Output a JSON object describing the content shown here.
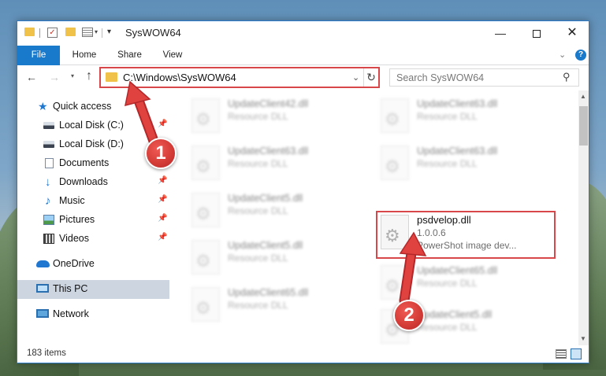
{
  "window": {
    "title": "SysWOW64",
    "controls": {
      "minimize": "—",
      "close": "✕"
    }
  },
  "quick_access_toolbar": {
    "check_glyph": "✓",
    "dropdown_glyph": "▾",
    "customize_glyph": "▾"
  },
  "ribbon": {
    "tabs": [
      "File",
      "Home",
      "Share",
      "View"
    ],
    "expand_glyph": "⌄",
    "help_glyph": "?"
  },
  "navigation": {
    "back_glyph": "←",
    "forward_glyph": "→",
    "recent_glyph": "▾",
    "up_glyph": "↑",
    "address_path": "C:\\Windows\\SysWOW64",
    "address_dropdown_glyph": "⌄",
    "refresh_glyph": "↻",
    "search_placeholder": "Search SysWOW64",
    "search_glyph": "⚲"
  },
  "sidebar": {
    "pin_glyph": "📌",
    "items": [
      {
        "label": "Quick access",
        "icon": "star-icon",
        "pinned": false
      },
      {
        "label": "Local Disk (C:)",
        "icon": "disk-icon",
        "pinned": true
      },
      {
        "label": "Local Disk (D:)",
        "icon": "disk-icon",
        "pinned": false
      },
      {
        "label": "Documents",
        "icon": "documents-icon",
        "pinned": true
      },
      {
        "label": "Downloads",
        "icon": "download-icon",
        "pinned": true
      },
      {
        "label": "Music",
        "icon": "music-icon",
        "pinned": true
      },
      {
        "label": "Pictures",
        "icon": "pictures-icon",
        "pinned": true
      },
      {
        "label": "Videos",
        "icon": "videos-icon",
        "pinned": true
      },
      {
        "label": "OneDrive",
        "icon": "onedrive-icon",
        "pinned": false
      },
      {
        "label": "This PC",
        "icon": "this-pc-icon",
        "pinned": false,
        "selected": true
      },
      {
        "label": "Network",
        "icon": "network-icon",
        "pinned": false
      }
    ]
  },
  "files": [
    {
      "name": "UpdateClient42.dll",
      "type": "Resource DLL",
      "blurred": true
    },
    {
      "name": "UpdateClient63.dll",
      "type": "Resource DLL",
      "blurred": true
    },
    {
      "name": "UpdateClient63.dll",
      "type": "Resource DLL",
      "blurred": true
    },
    {
      "name": "UpdateClient63.dll",
      "type": "Resource DLL",
      "blurred": true
    },
    {
      "name": "UpdateClient5.dll",
      "type": "Resource DLL",
      "blurred": true
    },
    {
      "name": "psdvelop.dll",
      "version": "1.0.0.6",
      "description": "PowerShot image dev...",
      "blurred": false,
      "highlighted": true
    },
    {
      "name": "UpdateClient5.dll",
      "type": "Resource DLL",
      "blurred": true
    },
    {
      "name": "UpdateClient65.dll",
      "type": "Resource DLL",
      "blurred": true
    },
    {
      "name": "UpdateClient65.dll",
      "type": "Resource DLL",
      "blurred": true
    },
    {
      "name": "UpdateClient5.dll",
      "type": "Resource DLL",
      "blurred": true
    }
  ],
  "scrollbar": {
    "up_glyph": "▲",
    "down_glyph": "▼"
  },
  "status": {
    "item_count": "183 items"
  },
  "annotations": [
    {
      "number": "1",
      "target": "address bar"
    },
    {
      "number": "2",
      "target": "psdvelop.dll"
    }
  ],
  "colors": {
    "accent": "#1979ca",
    "highlight_border": "#d8484a",
    "badge": "#d23a36",
    "arrow": "#e0433f"
  }
}
